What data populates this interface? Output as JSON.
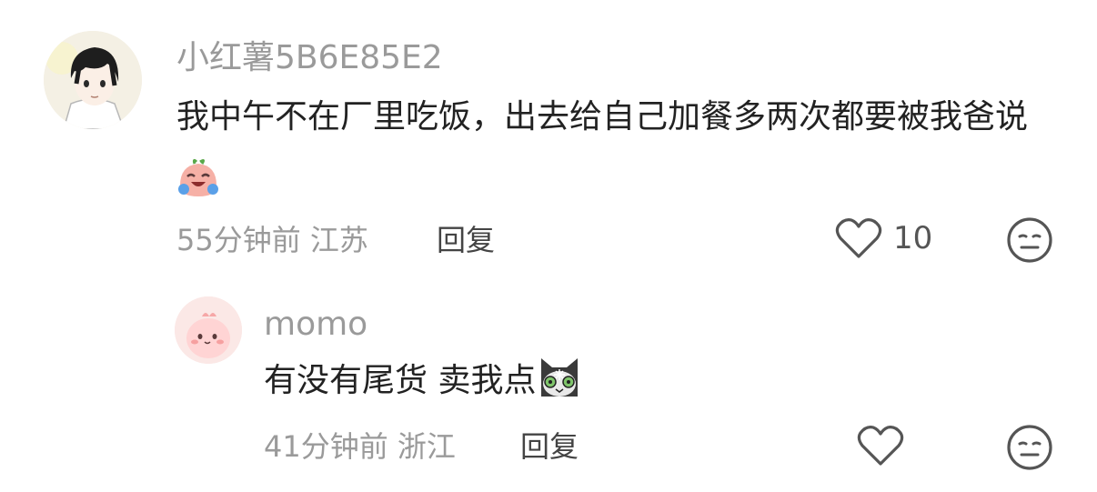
{
  "comments": [
    {
      "username": "小红薯5B6E85E2",
      "content": "我中午不在厂里吃饭，出去给自己加餐多两次都要被我爸说",
      "emoji": "crying-laughing-emoji",
      "time": "55分钟前",
      "location": "江苏",
      "reply_label": "回复",
      "like_count": "10"
    },
    {
      "username": "momo",
      "content": "有没有尾货 卖我点",
      "emoji": "cat-emoji",
      "time": "41分钟前",
      "location": "浙江",
      "reply_label": "回复",
      "like_count": ""
    }
  ],
  "icons": {
    "like": "heart-icon",
    "dislike": "meh-face-icon"
  },
  "colors": {
    "meta_text": "#9a9a9a",
    "body_text": "#222222",
    "icon_stroke": "#555555"
  }
}
